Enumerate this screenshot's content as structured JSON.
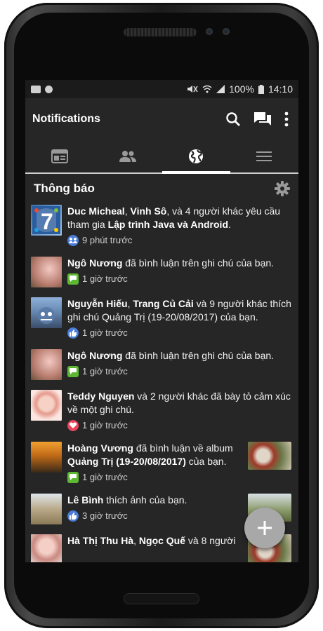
{
  "statusbar": {
    "battery": "100%",
    "time": "14:10"
  },
  "appbar": {
    "title": "Notifications"
  },
  "tabs": [
    {
      "icon": "news-feed-icon"
    },
    {
      "icon": "friends-icon"
    },
    {
      "icon": "globe-icon",
      "active": true
    },
    {
      "icon": "menu-icon"
    }
  ],
  "section": {
    "title": "Thông báo"
  },
  "notifications": [
    {
      "p1": "Duc Micheal",
      "t1": ", ",
      "p2": "Vinh Sô",
      "t2": ", và 4 người khác yêu cầu tham gia ",
      "p3": "Lập trình Java và Android",
      "t3": ".",
      "badge": "group-icon",
      "time": "9 phút trước"
    },
    {
      "p1": "Ngô Nương",
      "t1": " đã bình luận trên ghi chú của bạn.",
      "badge": "comment-icon",
      "time": "1 giờ trước"
    },
    {
      "p1": "Nguyễn Hiếu",
      "t1": ", ",
      "p2": "Trang Củ Cải",
      "t2": " và 9 người khác thích ghi chú Quảng Trị (19-20/08/2017) của bạn.",
      "badge": "like-icon",
      "time": "1 giờ trước"
    },
    {
      "p1": "Ngô Nương",
      "t1": " đã bình luận trên ghi chú của bạn.",
      "badge": "comment-icon",
      "time": "1 giờ trước"
    },
    {
      "p1": "Teddy Nguyen",
      "t1": " và 2 người khác đã bày tỏ cảm xúc về một ghi chú.",
      "badge": "love-icon",
      "time": "1 giờ trước"
    },
    {
      "p1": "Hoàng Vương",
      "t1": " đã bình luận về album ",
      "p2": "Quảng Trị (19-20/08/2017)",
      "t2": " của bạn.",
      "badge": "comment-icon",
      "time": "1 giờ trước"
    },
    {
      "p1": "Lê Bình",
      "t1": " thích ảnh của bạn.",
      "badge": "like-icon",
      "time": "3 giờ trước"
    },
    {
      "p1": "Hà Thị Thu Hà",
      "t1": ", ",
      "p2": "Ngọc Quế",
      "t2": " và 8 người",
      "badge": "",
      "time": ""
    }
  ],
  "fab": {
    "icon": "plus-icon"
  },
  "colors": {
    "screen_bg": "#262626",
    "statusbar_bg": "#1b1b1b",
    "like_blue": "#4a7cd8",
    "comment_green": "#5cb832",
    "love_red": "#e8455c",
    "fab": "#a8a8a8"
  }
}
